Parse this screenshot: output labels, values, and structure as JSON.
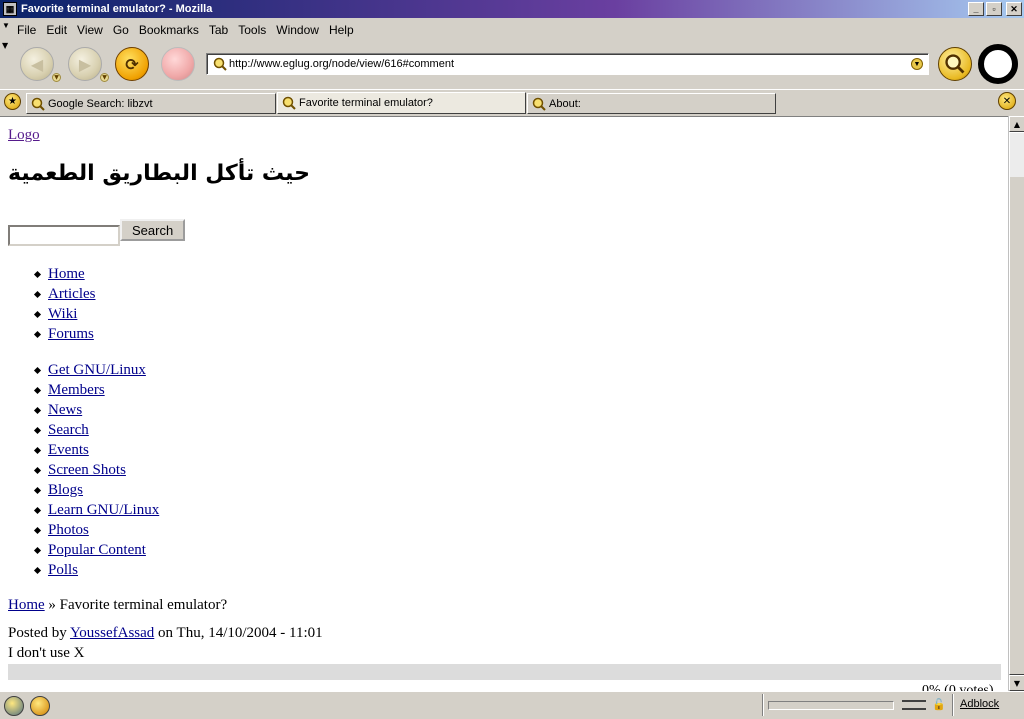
{
  "window": {
    "title": "Favorite terminal emulator? - Mozilla",
    "minimize": "_",
    "maximize": "▫",
    "close": "✕"
  },
  "menu": {
    "items": [
      "File",
      "Edit",
      "View",
      "Go",
      "Bookmarks",
      "Tab",
      "Tools",
      "Window",
      "Help"
    ]
  },
  "toolbar": {
    "url": "http://www.eglug.org/node/view/616#comment"
  },
  "tabs": [
    {
      "label": "Google Search: libzvt",
      "active": false
    },
    {
      "label": "Favorite terminal emulator?",
      "active": true
    },
    {
      "label": "About:",
      "active": false
    }
  ],
  "page": {
    "logo_link": "Logo",
    "site_title": "حيث تأكل البطاريق الطعمية",
    "search_button": "Search",
    "nav_primary": [
      "Home",
      "Articles",
      "Wiki",
      "Forums"
    ],
    "nav_secondary": [
      "Get GNU/Linux",
      "Members",
      "News",
      "Search",
      "Events",
      "Screen Shots",
      "Blogs",
      "Learn GNU/Linux",
      "Photos",
      "Popular Content",
      "Polls"
    ],
    "breadcrumb_home": "Home",
    "breadcrumb_sep": "»",
    "breadcrumb_current": "Favorite terminal emulator?",
    "posted_prefix": "Posted by",
    "posted_author": "YoussefAssad",
    "posted_suffix": "on Thu, 14/10/2004 - 11:01",
    "comment_text": "I don't use X",
    "votes_text": "0% (0 votes)"
  },
  "statusbar": {
    "adblock": "Adblock"
  },
  "colors": {
    "link": "#00008b",
    "visited": "#551a8b",
    "titlebar_start": "#0a246a",
    "chrome": "#d4d0c8"
  }
}
